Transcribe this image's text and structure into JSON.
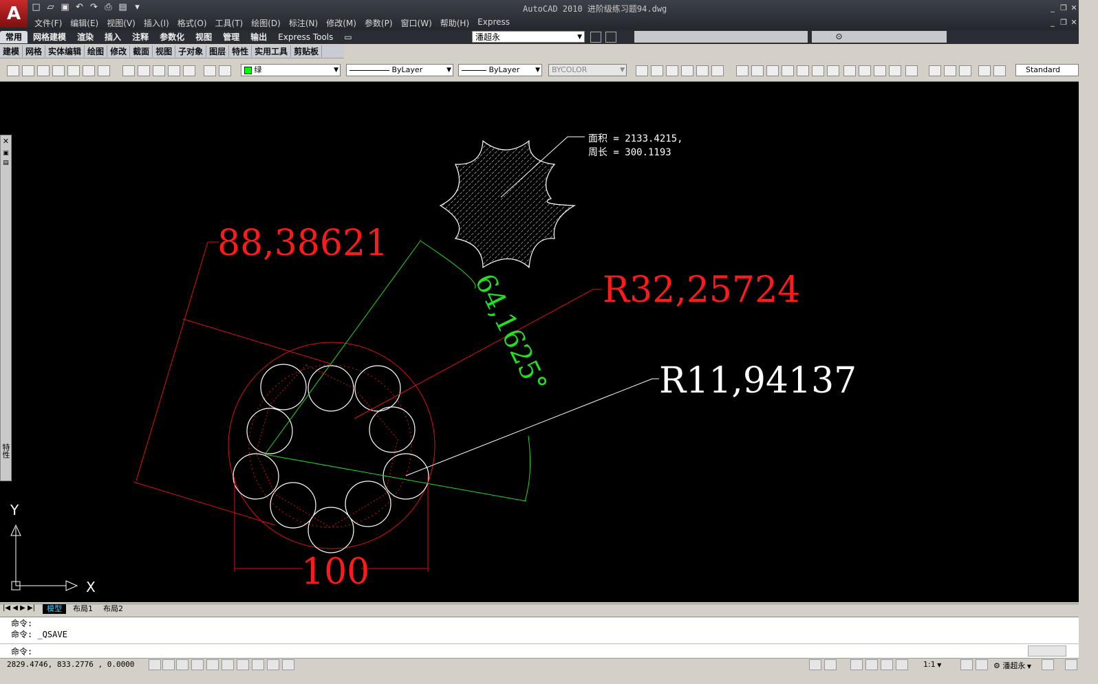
{
  "window": {
    "title": "AutoCAD 2010    进阶级练习题94.dwg"
  },
  "menubar": [
    "文件(F)",
    "编辑(E)",
    "视图(V)",
    "插入(I)",
    "格式(O)",
    "工具(T)",
    "绘图(D)",
    "标注(N)",
    "修改(M)",
    "参数(P)",
    "窗口(W)",
    "帮助(H)",
    "Express"
  ],
  "ribbon": {
    "tabs": [
      "常用",
      "网格建模",
      "渲染",
      "插入",
      "注释",
      "参数化",
      "视图",
      "管理",
      "输出",
      "Express Tools"
    ],
    "active_tab": "常用",
    "workspace_user": "潘超永"
  },
  "panels": [
    "建模",
    "网格",
    "实体编辑",
    "绘图",
    "修改",
    "截面",
    "视图",
    "子对象",
    "图层",
    "特性",
    "实用工具",
    "剪贴板"
  ],
  "properties": {
    "color": "绿",
    "linetype": "ByLayer",
    "lineweight": "ByLayer",
    "plotstyle": "BYCOLOR",
    "textstyle": "Standard"
  },
  "drawing": {
    "area_label": "面积 = 2133.4215,",
    "perimeter_label": "周长 = 300.1193",
    "dim_aligned": "88,38621",
    "dim_radius_outer": "R32,25724",
    "dim_angle": "64,1625°",
    "dim_radius_small": "R11,94137",
    "dim_linear": "100",
    "ucs_x": "X",
    "ucs_y": "Y",
    "palette_label": "特性"
  },
  "layout_tabs": [
    "模型",
    "布局1",
    "布局2"
  ],
  "command": {
    "prompt": "命令:",
    "history_1": "命令:",
    "history_2": "命令: _QSAVE",
    "current": "命令:"
  },
  "status": {
    "coords": "2829.4746, 833.2776 , 0.0000",
    "annotation_scale": "1:1",
    "workspace": "潘超永"
  },
  "colors": {
    "canvas": "#000000",
    "dim_red": "#ff1a1a",
    "dim_green": "#22dd22",
    "white": "#ffffff"
  }
}
